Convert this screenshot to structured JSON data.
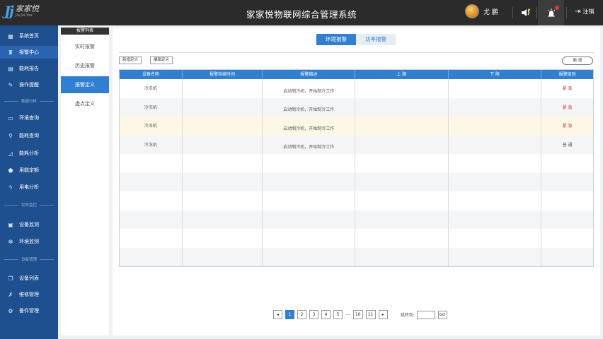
{
  "header": {
    "logo_mark": "Jj",
    "logo_cn": "家家悦",
    "logo_en": "Jia Jia Yue",
    "title": "家家悦物联网综合管理系统",
    "user_name": "尤 鹏",
    "logout_label": "注销"
  },
  "sidebar": {
    "items": [
      {
        "label": "系统首页",
        "icon": "grid-icon"
      },
      {
        "label": "报警中心",
        "icon": "alarm-icon"
      },
      {
        "label": "能耗报告",
        "icon": "report-icon"
      },
      {
        "label": "操作提醒",
        "icon": "wrench-icon"
      },
      {
        "label": "环境查询",
        "icon": "monitor-icon"
      },
      {
        "label": "能耗查询",
        "icon": "search-icon"
      },
      {
        "label": "能耗分析",
        "icon": "chart-icon"
      },
      {
        "label": "用能定额",
        "icon": "shield-icon"
      },
      {
        "label": "用电分析",
        "icon": "bolt-icon"
      },
      {
        "label": "设备监测",
        "icon": "device-icon"
      },
      {
        "label": "环境监测",
        "icon": "snowflake-icon"
      },
      {
        "label": "设备列表",
        "icon": "list-icon"
      },
      {
        "label": "维修管理",
        "icon": "tools-icon"
      },
      {
        "label": "备件管理",
        "icon": "parts-icon"
      }
    ],
    "groups": [
      "数据分析",
      "实时监控",
      "设备管理"
    ]
  },
  "submenu": {
    "title": "报警列表",
    "items": [
      "实时报警",
      "历史报警",
      "报警定义",
      "虚点定义"
    ]
  },
  "tabs": [
    "环境报警",
    "功率报警"
  ],
  "toolbar": {
    "add": "新增定义",
    "edit": "编辑定义",
    "new": "新 增"
  },
  "table": {
    "headers": [
      "设备名称",
      "报警持续时间",
      "报警描述",
      "上 限",
      "下 限",
      "报警级别"
    ],
    "rows": [
      {
        "device": "冷冻机",
        "duration": "",
        "desc": "启动制冷机，开始制冷工作",
        "upper": "",
        "lower": "",
        "level": "紧 急"
      },
      {
        "device": "冷冻机",
        "duration": "",
        "desc": "启动制冷机，开始制冷工作",
        "upper": "",
        "lower": "",
        "level": "紧 急"
      },
      {
        "device": "冷冻机",
        "duration": "",
        "desc": "启动制冷机，开始制冷工作",
        "upper": "",
        "lower": "",
        "level": "紧 急"
      },
      {
        "device": "冷冻机",
        "duration": "",
        "desc": "启动制冷机，开始制冷工作",
        "upper": "",
        "lower": "",
        "level": "普 通"
      }
    ]
  },
  "pagination": {
    "pages": [
      "1",
      "2",
      "3",
      "4",
      "5",
      "10",
      "11"
    ],
    "current": "1",
    "dots": "···",
    "jump_label": "跳转到:",
    "go": "GO"
  },
  "colors": {
    "accent": "#2f7fd2",
    "sidebar": "#1e4f8f",
    "urgent": "#d23030"
  }
}
